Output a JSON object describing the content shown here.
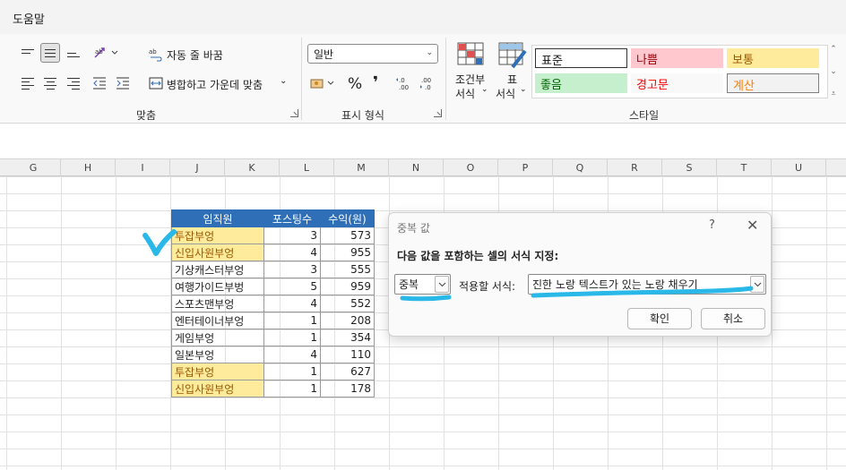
{
  "menu": {
    "help": "도움말"
  },
  "ribbon": {
    "alignment": {
      "wrap_text": "자동 줄 바꿈",
      "merge_center": "병합하고 가운데 맞춤",
      "group_label": "맞춤"
    },
    "number": {
      "format_value": "일반",
      "percent": "%",
      "comma": "❜",
      "group_label": "표시 형식"
    },
    "styles": {
      "conditional_line1": "조건부",
      "conditional_line2": "서식",
      "table_line1": "표",
      "table_line2": "서식",
      "cells": [
        {
          "label": "표준",
          "bg": "#ffffff",
          "fg": "#111111"
        },
        {
          "label": "나쁨",
          "bg": "#ffc7ce",
          "fg": "#9c0006"
        },
        {
          "label": "보통",
          "bg": "#ffeb9c",
          "fg": "#9c5700"
        },
        {
          "label": "좋음",
          "bg": "#c6efce",
          "fg": "#006100"
        },
        {
          "label": "경고문",
          "bg": "#f9f9f9",
          "fg": "#ff0000"
        },
        {
          "label": "계산",
          "bg": "#f2f2f2",
          "fg": "#fa7d00"
        }
      ],
      "group_label": "스타일"
    }
  },
  "columns": [
    "G",
    "H",
    "I",
    "J",
    "K",
    "L",
    "M",
    "N",
    "O",
    "P",
    "Q",
    "R",
    "S",
    "T",
    "U"
  ],
  "table": {
    "headers": [
      "임직원",
      "포스팅수",
      "수익(원)"
    ],
    "rows": [
      {
        "name": "투잡부엉",
        "posts": "3",
        "revenue": "573",
        "duplicate": true
      },
      {
        "name": "신입사원부엉",
        "posts": "4",
        "revenue": "955",
        "duplicate": true
      },
      {
        "name": "기상캐스터부엉",
        "posts": "3",
        "revenue": "555",
        "duplicate": false
      },
      {
        "name": "여행가이드부벙",
        "posts": "5",
        "revenue": "959",
        "duplicate": false
      },
      {
        "name": "스포츠맨부엉",
        "posts": "4",
        "revenue": "552",
        "duplicate": false
      },
      {
        "name": "엔터테이너부엉",
        "posts": "1",
        "revenue": "208",
        "duplicate": false
      },
      {
        "name": "게임부엉",
        "posts": "1",
        "revenue": "354",
        "duplicate": false
      },
      {
        "name": "일본부엉",
        "posts": "4",
        "revenue": "110",
        "duplicate": false
      },
      {
        "name": "투잡부엉",
        "posts": "1",
        "revenue": "627",
        "duplicate": true
      },
      {
        "name": "신입사원부엉",
        "posts": "1",
        "revenue": "178",
        "duplicate": true
      }
    ]
  },
  "dialog": {
    "title": "중복 값",
    "help": "?",
    "close": "✕",
    "prompt": "다음 값을 포함하는 셀의 서식 지정:",
    "values_option": "중복",
    "apply_label": "적용할 서식:",
    "format_option": "진한 노랑 텍스트가 있는 노랑 채우기",
    "ok": "확인",
    "cancel": "취소"
  },
  "colors": {
    "header_blue": "#2e6fb7",
    "dup_fill": "#ffeb9c",
    "dup_text": "#9c5700",
    "annotation": "#29b8e8"
  }
}
